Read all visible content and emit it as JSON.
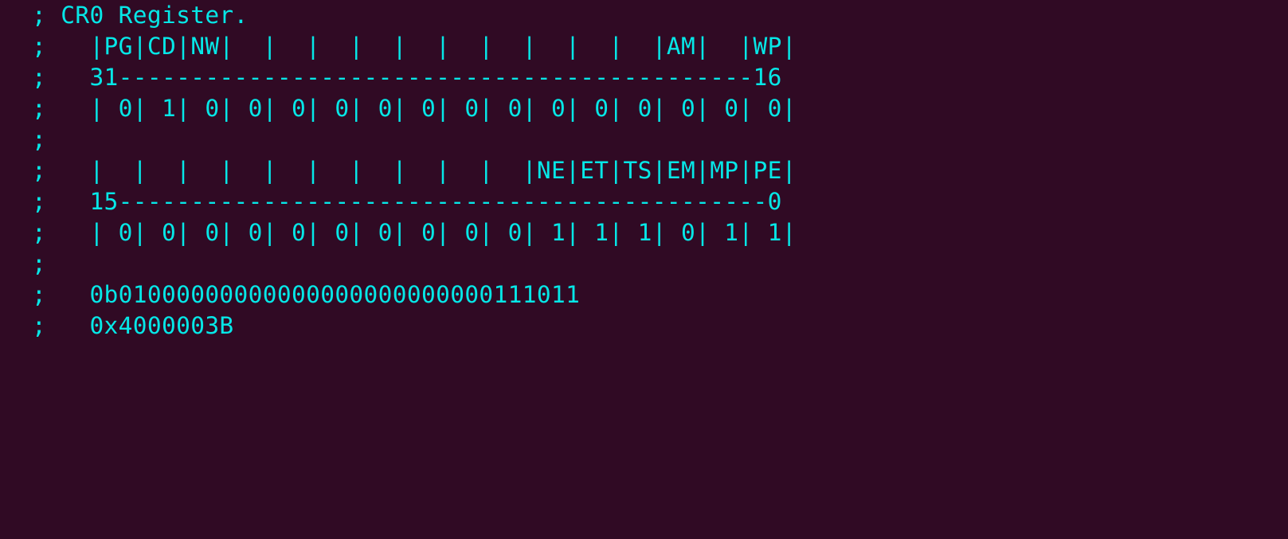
{
  "terminal": {
    "lines": [
      "; CR0 Register.",
      ";   |PG|CD|NW|  |  |  |  |  |  |  |  |  |  |AM|  |WP|",
      ";   31--------------------------------------------16",
      ";   | 0| 1| 0| 0| 0| 0| 0| 0| 0| 0| 0| 0| 0| 0| 0| 0|",
      ";",
      ";   |  |  |  |  |  |  |  |  |  |  |NE|ET|TS|EM|MP|PE|",
      ";   15---------------------------------------------0",
      ";   | 0| 0| 0| 0| 0| 0| 0| 0| 0| 0| 1| 1| 1| 0| 1| 1|",
      ";",
      ";   0b01000000000000000000000000111011",
      ";   0x4000003B"
    ]
  },
  "colors": {
    "background": "#300a24",
    "text": "#06e7e7"
  }
}
